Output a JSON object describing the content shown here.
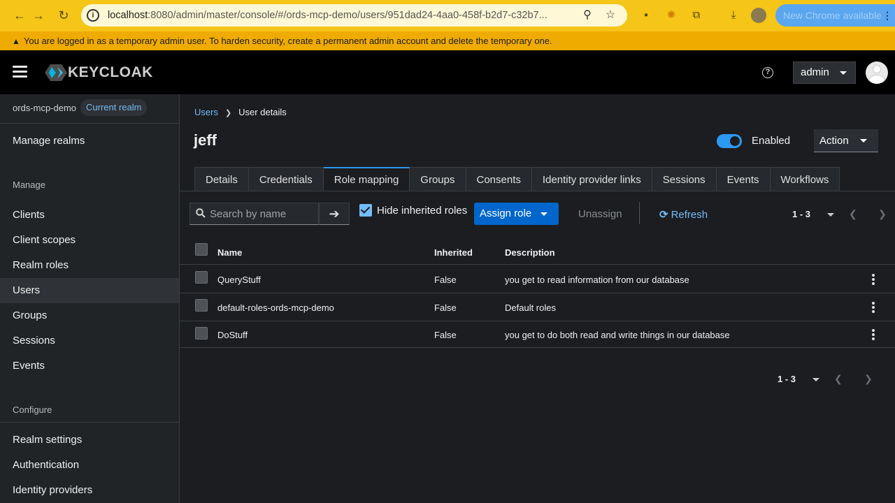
{
  "browser": {
    "url_host": "localhost",
    "url_path": ":8080/admin/master/console/#/ords-mcp-demo/users/951dad24-4aa0-458f-b2d7-c32b7...",
    "update_label": "New Chrome available"
  },
  "banner": {
    "text": "You are logged in as a temporary admin user. To harden security, create a permanent admin account and delete the temporary one."
  },
  "masthead": {
    "logo_text": "KEYCLOAK",
    "user_label": "admin"
  },
  "sidebar": {
    "realm_name": "ords-mcp-demo",
    "realm_badge": "Current realm",
    "manage_realms": "Manage realms",
    "manage_section": "Manage",
    "items": [
      {
        "label": "Clients"
      },
      {
        "label": "Client scopes"
      },
      {
        "label": "Realm roles"
      },
      {
        "label": "Users"
      },
      {
        "label": "Groups"
      },
      {
        "label": "Sessions"
      },
      {
        "label": "Events"
      }
    ],
    "configure_section": "Configure",
    "configure_items": [
      {
        "label": "Realm settings"
      },
      {
        "label": "Authentication"
      },
      {
        "label": "Identity providers"
      }
    ]
  },
  "main": {
    "breadcrumb": {
      "link": "Users",
      "current": "User details"
    },
    "title": "jeff",
    "enabled_label": "Enabled",
    "enabled": true,
    "action_label": "Action",
    "tabs": [
      {
        "label": "Details"
      },
      {
        "label": "Credentials"
      },
      {
        "label": "Role mapping"
      },
      {
        "label": "Groups"
      },
      {
        "label": "Consents"
      },
      {
        "label": "Identity provider links"
      },
      {
        "label": "Sessions"
      },
      {
        "label": "Events"
      },
      {
        "label": "Workflows"
      }
    ],
    "active_tab": "Role mapping",
    "toolbar": {
      "search_placeholder": "Search by name",
      "hide_inherited_label": "Hide inherited roles",
      "hide_inherited_checked": true,
      "assign_label": "Assign role",
      "unassign_label": "Unassign",
      "refresh_label": "Refresh",
      "pagination": "1 - 3"
    },
    "table": {
      "columns": [
        "Name",
        "Inherited",
        "Description"
      ],
      "rows": [
        {
          "name": "QueryStuff",
          "inherited": "False",
          "description": "you get to read information from our database"
        },
        {
          "name": "default-roles-ords-mcp-demo",
          "inherited": "False",
          "description": "Default roles"
        },
        {
          "name": "DoStuff",
          "inherited": "False",
          "description": "you get to do both read and write things in our database"
        }
      ]
    },
    "footer_pagination": "1 - 3"
  },
  "colors": {
    "accent": "#2b9af3",
    "link": "#73bcf7",
    "primary_button": "#0066cc",
    "warning": "#f0ab00",
    "chrome_bar": "#f5c518"
  }
}
